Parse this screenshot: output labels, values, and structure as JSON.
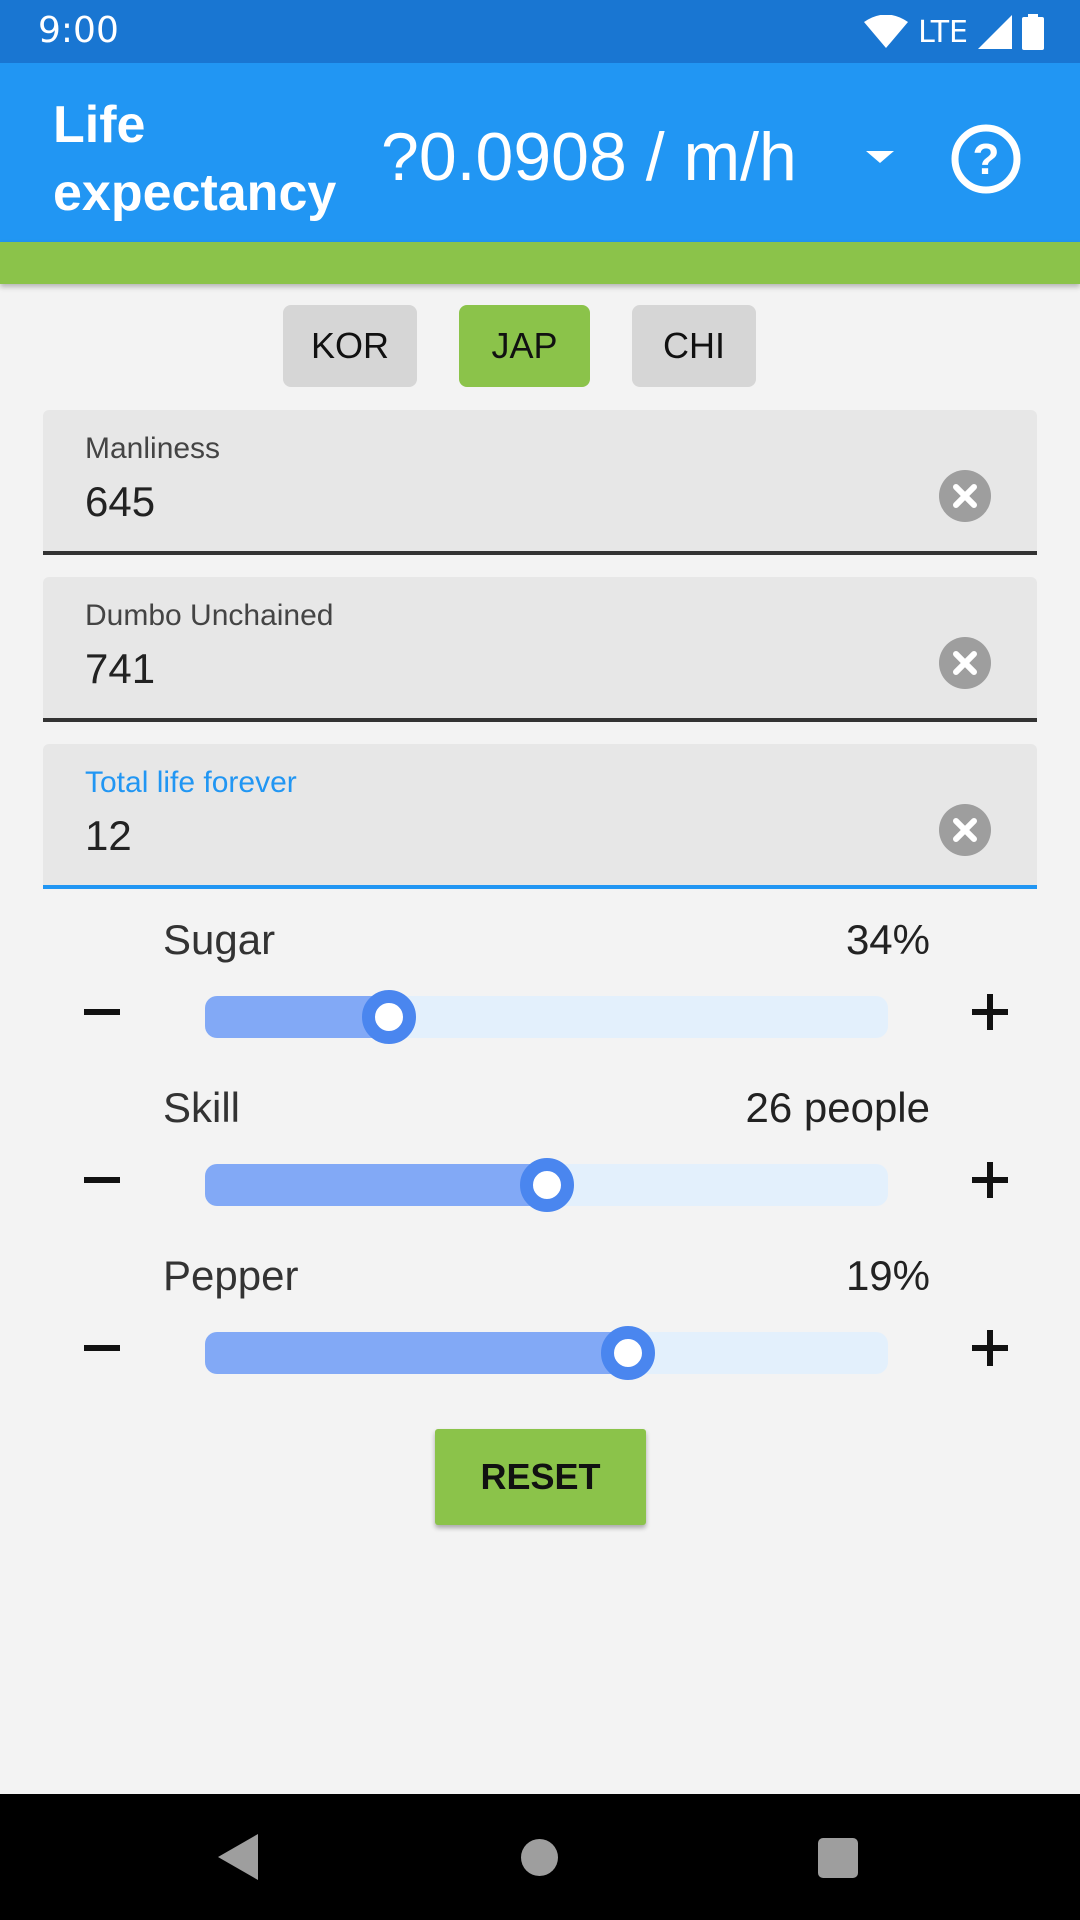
{
  "status_bar": {
    "time": "9:00",
    "network": "LTE",
    "icons": [
      "wifi-icon",
      "signal-icon",
      "battery-icon"
    ]
  },
  "app_bar": {
    "title": "Life expectancy",
    "rate": "?0.0908 / m/h",
    "icons": [
      "dropdown-arrow-icon",
      "help-icon"
    ]
  },
  "tabs": [
    {
      "label": "KOR",
      "active": false
    },
    {
      "label": "JAP",
      "active": true
    },
    {
      "label": "CHI",
      "active": false
    }
  ],
  "fields": [
    {
      "label": "Manliness",
      "value": "645",
      "focused": false
    },
    {
      "label": "Dumbo Unchained",
      "value": "741",
      "focused": false
    },
    {
      "label": "Total life forever",
      "value": "12",
      "focused": true
    }
  ],
  "sliders": [
    {
      "label": "Sugar",
      "value_text": "34%",
      "level": 0.27
    },
    {
      "label": "Skill",
      "value_text": "26 people",
      "level": 0.5
    },
    {
      "label": "Pepper",
      "value_text": "19%",
      "level": 0.62
    }
  ],
  "reset_label": "RESET",
  "colors": {
    "status_bar": "#1976d2",
    "app_bar": "#2196f3",
    "accent_green": "#8bc34a",
    "slider_thumb": "#4a86ef",
    "slider_fill": "#82a9f6",
    "slider_track": "#e3f0fc"
  }
}
